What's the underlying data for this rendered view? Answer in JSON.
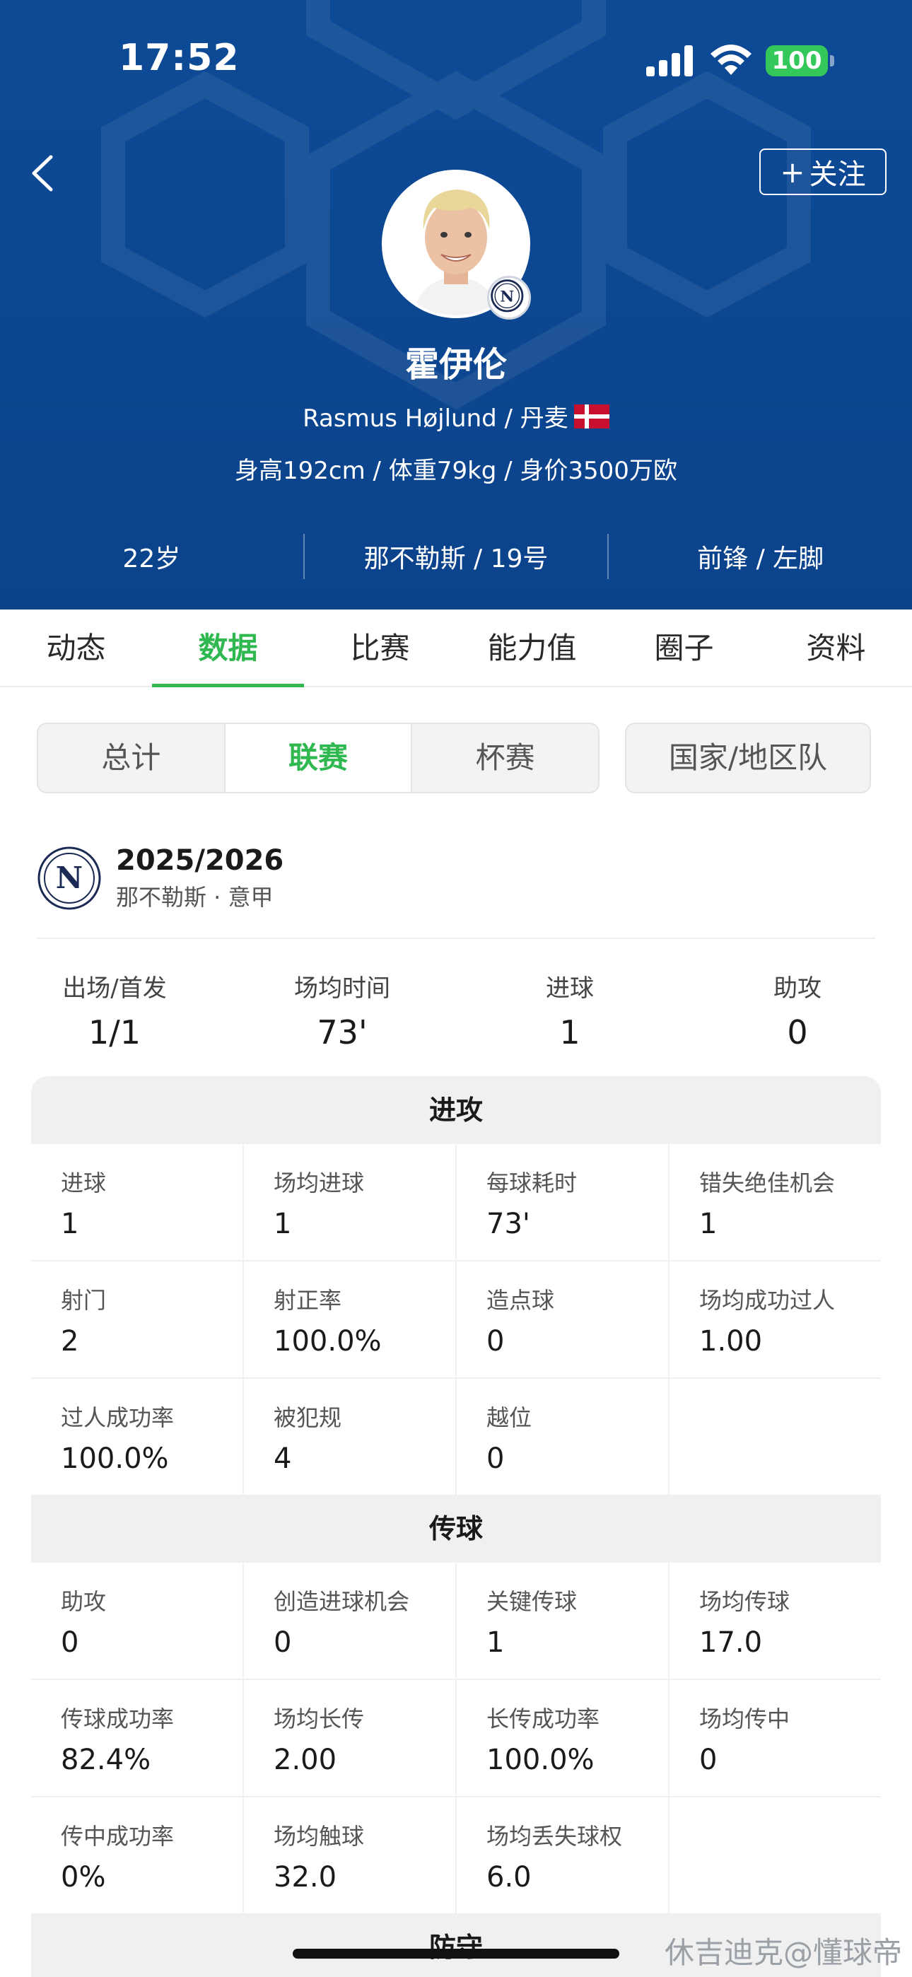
{
  "status": {
    "time": "17:52",
    "battery": "100"
  },
  "header": {
    "follow_label": "关注",
    "player_name": "霍伊伦",
    "player_latin": "Rasmus Højlund / 丹麦",
    "body_info": "身高192cm / 体重79kg / 身价3500万欧",
    "age": "22岁",
    "club_number": "那不勒斯 / 19号",
    "position_foot": "前锋 / 左脚",
    "flag_colors": [
      "#c8102e",
      "#ffffff"
    ]
  },
  "tabs": [
    {
      "label": "动态"
    },
    {
      "label": "数据"
    },
    {
      "label": "比赛"
    },
    {
      "label": "能力值"
    },
    {
      "label": "圈子"
    },
    {
      "label": "资料"
    }
  ],
  "segments": [
    "总计",
    "联赛",
    "杯赛"
  ],
  "segment_country": "国家/地区队",
  "season": {
    "year": "2025/2026",
    "sub": "那不勒斯 · 意甲"
  },
  "summary": [
    {
      "label": "出场/首发",
      "value": "1/1"
    },
    {
      "label": "场均时间",
      "value": "73'"
    },
    {
      "label": "进球",
      "value": "1"
    },
    {
      "label": "助攻",
      "value": "0"
    }
  ],
  "attack": {
    "title": "进攻",
    "cells": [
      {
        "label": "进球",
        "value": "1"
      },
      {
        "label": "场均进球",
        "value": "1"
      },
      {
        "label": "每球耗时",
        "value": "73'"
      },
      {
        "label": "错失绝佳机会",
        "value": "1"
      },
      {
        "label": "射门",
        "value": "2"
      },
      {
        "label": "射正率",
        "value": "100.0%"
      },
      {
        "label": "造点球",
        "value": "0"
      },
      {
        "label": "场均成功过人",
        "value": "1.00"
      },
      {
        "label": "过人成功率",
        "value": "100.0%"
      },
      {
        "label": "被犯规",
        "value": "4"
      },
      {
        "label": "越位",
        "value": "0"
      },
      {
        "label": "",
        "value": ""
      }
    ]
  },
  "passing": {
    "title": "传球",
    "cells": [
      {
        "label": "助攻",
        "value": "0"
      },
      {
        "label": "创造进球机会",
        "value": "0"
      },
      {
        "label": "关键传球",
        "value": "1"
      },
      {
        "label": "场均传球",
        "value": "17.0"
      },
      {
        "label": "传球成功率",
        "value": "82.4%"
      },
      {
        "label": "场均长传",
        "value": "2.00"
      },
      {
        "label": "长传成功率",
        "value": "100.0%"
      },
      {
        "label": "场均传中",
        "value": "0"
      },
      {
        "label": "传中成功率",
        "value": "0%"
      },
      {
        "label": "场均触球",
        "value": "32.0"
      },
      {
        "label": "场均丢失球权",
        "value": "6.0"
      },
      {
        "label": "",
        "value": ""
      }
    ]
  },
  "defense": {
    "title": "防守"
  },
  "watermark": "休吉迪克@懂球帝",
  "colors": {
    "header_blue": "#0c4690",
    "accent_green": "#2eb84f",
    "battery_green": "#34c759"
  }
}
